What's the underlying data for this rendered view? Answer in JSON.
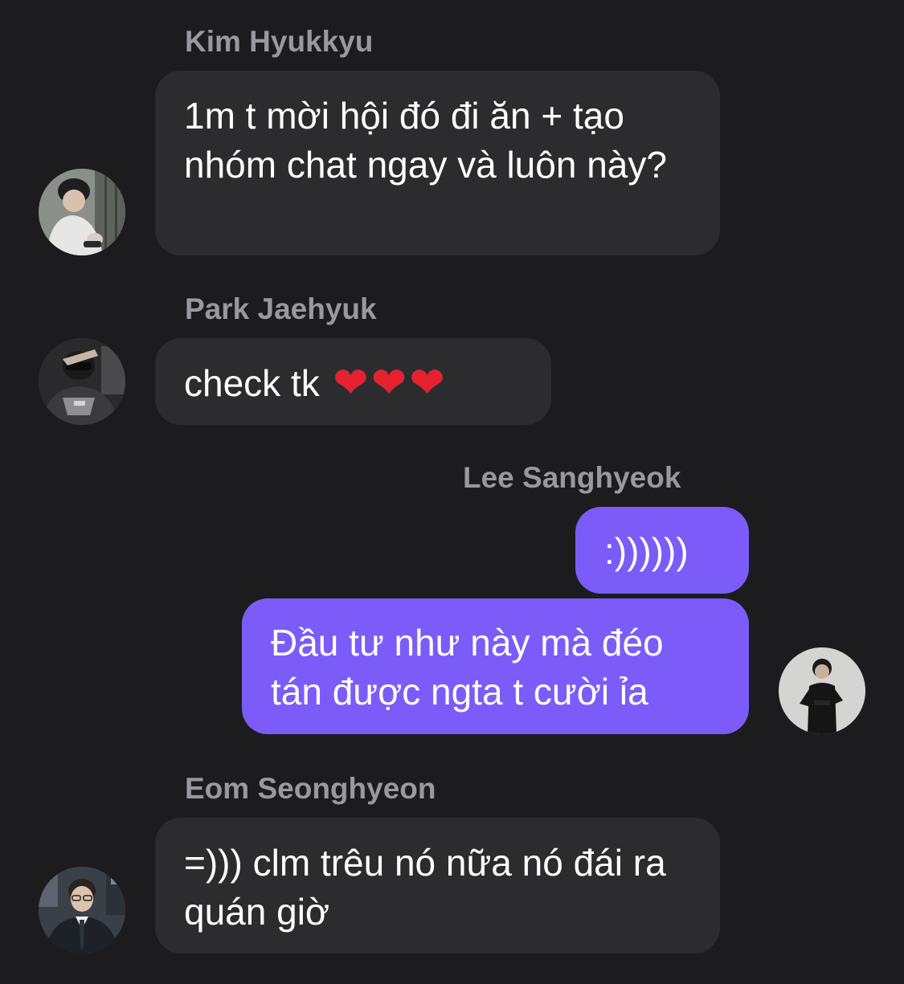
{
  "messages": [
    {
      "sender": "Kim Hyukkyu",
      "text": "1m t mời hội đó đi ăn + tạo nhóm chat ngay và luôn này?",
      "avatar_icon": "user-photo-icon"
    },
    {
      "sender": "Park Jaehyuk",
      "text": "check tk",
      "emoji": [
        "❤",
        "❤",
        "❤"
      ],
      "avatar_icon": "user-photo-icon"
    },
    {
      "sender": "Lee Sanghyeok",
      "texts": [
        ":))))))",
        "Đầu tư như này mà đéo tán được ngta t cười ỉa"
      ],
      "avatar_icon": "user-photo-icon"
    },
    {
      "sender": "Eom Seonghyeon",
      "text": "=))) clm trêu nó nữa nó đái ra quán giờ",
      "avatar_icon": "user-photo-icon"
    }
  ],
  "colors": {
    "background": "#1c1c1e",
    "incoming_bubble": "#2c2c2e",
    "outgoing_bubble": "#7b5cf8",
    "sender_name": "#98989e",
    "text": "#ffffff",
    "heart": "#e7212f"
  }
}
